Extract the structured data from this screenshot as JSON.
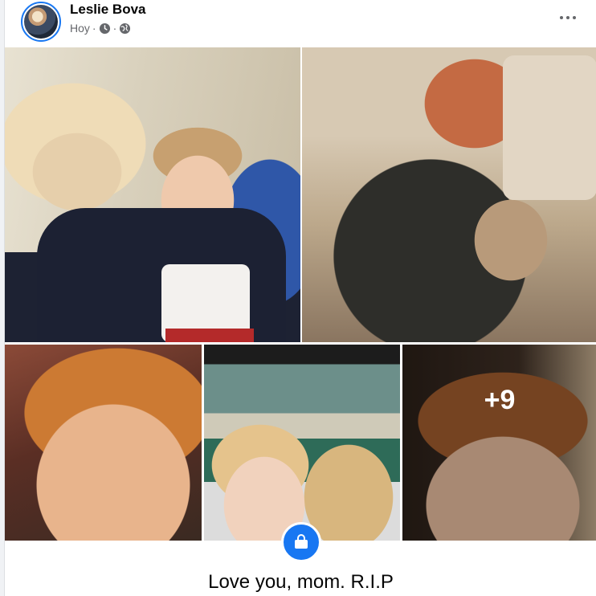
{
  "post": {
    "author": "Leslie Bova",
    "time": "Hoy",
    "sep1": "·",
    "sep2": "·",
    "more_photos": "+9",
    "caption": "Love you, mom. R.I.P"
  },
  "icons": {
    "clock": "clock-icon",
    "privacy": "globe-icon",
    "menu": "more-options-icon",
    "badge": "shopping-bag-icon"
  },
  "colors": {
    "accent": "#1877f2",
    "secondary_text": "#65676b"
  }
}
